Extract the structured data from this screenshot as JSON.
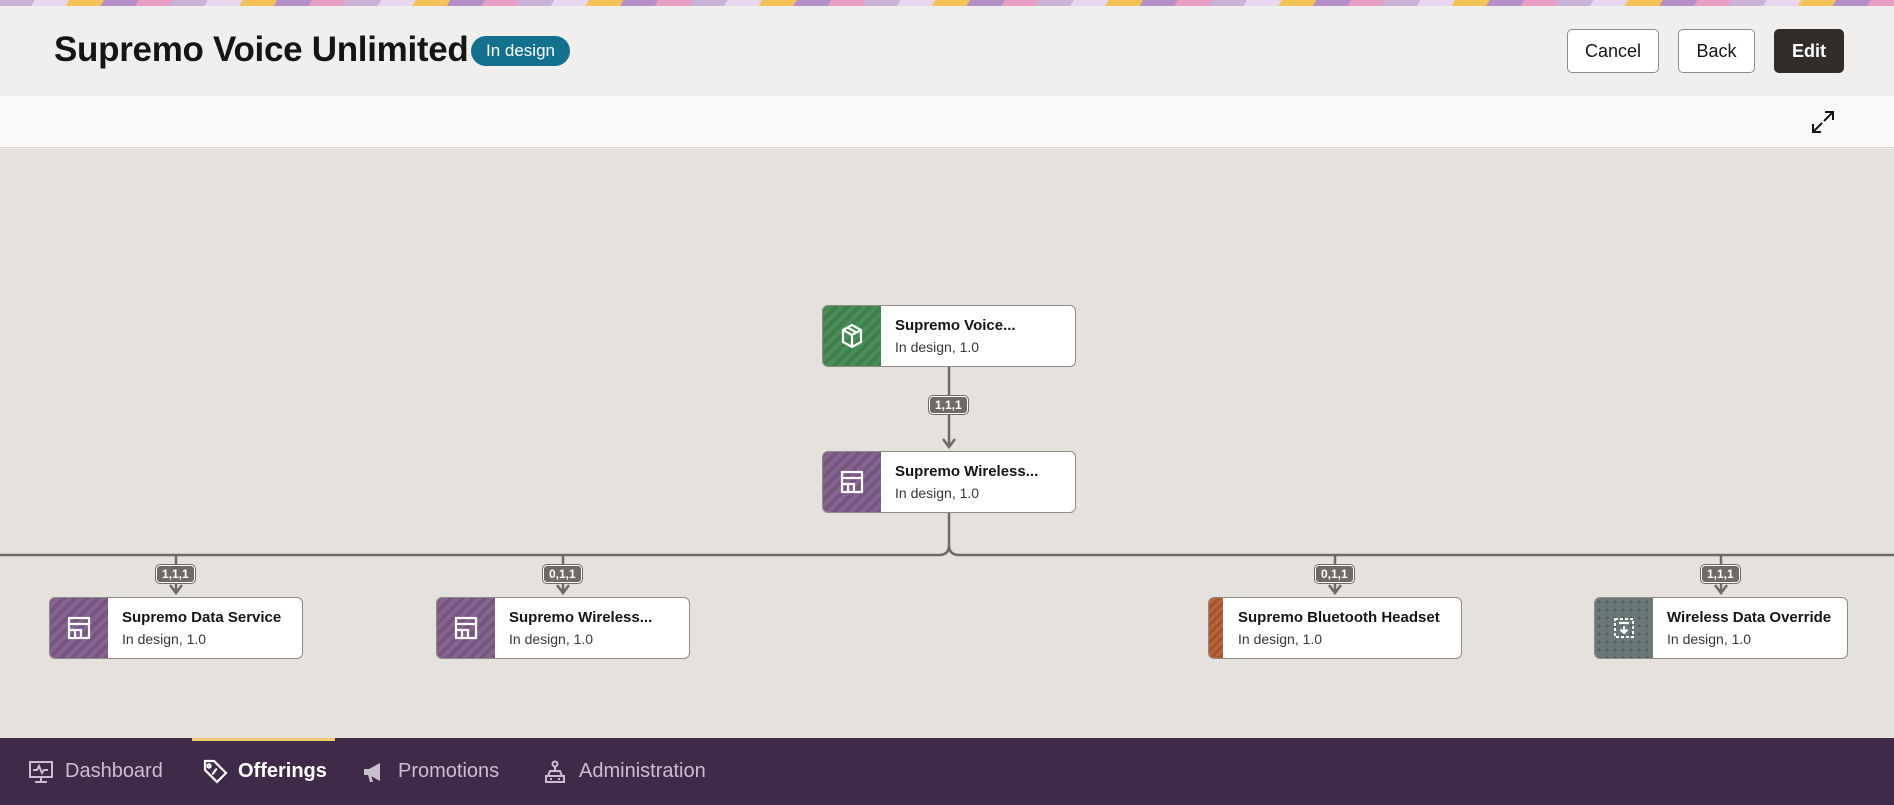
{
  "header": {
    "title": "Supremo Voice Unlimited",
    "status_badge": "In design",
    "buttons": {
      "cancel": "Cancel",
      "back": "Back",
      "edit": "Edit"
    }
  },
  "toolbar": {
    "expand_icon": "expand-icon"
  },
  "hierarchy": {
    "root": {
      "name": "Supremo Voice...",
      "meta": "In design, 1.0",
      "icon": "package-icon",
      "color": "#3f7f4d"
    },
    "child": {
      "name": "Supremo Wireless...",
      "meta": "In design, 1.0",
      "icon": "service-icon",
      "color": "#76567f",
      "cardinality": "1,1,1"
    },
    "leaves": [
      {
        "name": "Supremo Data Service",
        "meta": "In design, 1.0",
        "icon": "service-icon",
        "color": "#76567f",
        "cardinality": "1,1,1"
      },
      {
        "name": "Supremo Wireless...",
        "meta": "In design, 1.0",
        "icon": "service-icon",
        "color": "#76567f",
        "cardinality": "0,1,1"
      },
      {
        "name": "Supremo Bluetooth Headset",
        "meta": "In design, 1.0",
        "icon": "device-swatch",
        "color": "#a4542d",
        "cardinality": "0,1,1"
      },
      {
        "name": "Wireless Data Override",
        "meta": "In design, 1.0",
        "icon": "override-icon",
        "color": "#6c7877",
        "cardinality": "1,1,1"
      }
    ]
  },
  "bottom_nav": {
    "items": [
      {
        "label": "Dashboard",
        "icon": "dashboard-icon"
      },
      {
        "label": "Offerings",
        "icon": "offerings-icon",
        "active": true
      },
      {
        "label": "Promotions",
        "icon": "megaphone-icon"
      },
      {
        "label": "Administration",
        "icon": "admin-icon"
      }
    ]
  }
}
